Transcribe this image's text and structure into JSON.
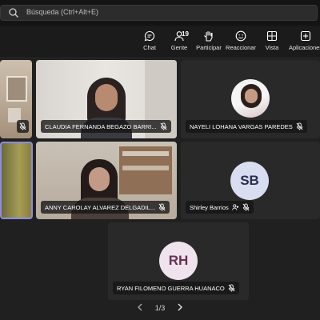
{
  "search": {
    "placeholder": "Búsqueda (Ctrl+Alt+E)"
  },
  "toolbar": {
    "chat": "Chat",
    "people": "Gente",
    "people_count": "19",
    "raise": "Participar",
    "react": "Reaccionar",
    "view": "Vista",
    "apps": "Aplicaciones"
  },
  "tiles": {
    "claudia": {
      "name": "CLAUDIA FERNANDA BEGAZO BARRI..."
    },
    "nayeli": {
      "name": "NAYELI LOHANA VARGAS PAREDES"
    },
    "anny": {
      "name": "ANNY CAROLAY ALVAREZ DELGADIL..."
    },
    "shirley": {
      "name": "Shirley Barrios",
      "initials": "SB"
    },
    "ryan": {
      "name": "RYAN FILOMENO GUERRA HUANACO",
      "initials": "RH"
    }
  },
  "pager": {
    "label": "1/3"
  },
  "colors": {
    "avatar_bg": "#d8def0",
    "avatar_rh_bg": "#efe3ee",
    "active_border": "#8c8ce0"
  }
}
